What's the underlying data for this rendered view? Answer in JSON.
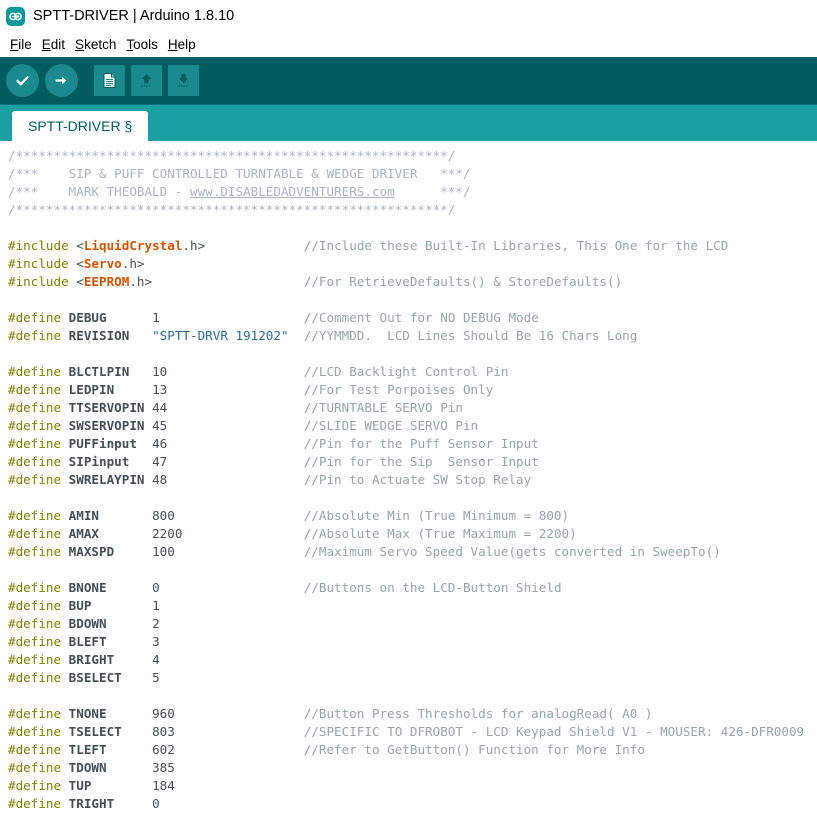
{
  "window": {
    "title": "SPTT-DRIVER | Arduino 1.8.10",
    "logo_icon": "arduino-infinity-icon"
  },
  "menubar": {
    "items": [
      {
        "label": "File",
        "mnemonic": "F",
        "rest": "ile"
      },
      {
        "label": "Edit",
        "mnemonic": "E",
        "rest": "dit"
      },
      {
        "label": "Sketch",
        "mnemonic": "S",
        "rest": "ketch"
      },
      {
        "label": "Tools",
        "mnemonic": "T",
        "rest": "ools"
      },
      {
        "label": "Help",
        "mnemonic": "H",
        "rest": "elp"
      }
    ]
  },
  "toolbar": {
    "buttons": [
      {
        "name": "verify-button",
        "icon": "checkmark-icon",
        "tooltip": "Verify"
      },
      {
        "name": "upload-button",
        "icon": "arrow-right-icon",
        "tooltip": "Upload"
      },
      {
        "name": "new-button",
        "icon": "new-document-icon",
        "tooltip": "New"
      },
      {
        "name": "open-button",
        "icon": "arrow-up-icon",
        "tooltip": "Open"
      },
      {
        "name": "save-button",
        "icon": "arrow-down-icon",
        "tooltip": "Save"
      }
    ]
  },
  "tabs": [
    {
      "label": "SPTT-DRIVER §",
      "active": true
    }
  ],
  "colors": {
    "toolbar_bg": "#005c5f",
    "tabbar_bg": "#1a9fa3",
    "button_bg": "#1a8a8e",
    "accent": "#00979d",
    "comment": "#a8b5c0",
    "preprocessor": "#7e7e00",
    "library": "#d35400",
    "string": "#2d6e8e",
    "identifier": "#434f54"
  },
  "code": {
    "banner": {
      "rule_top": "/*********************************************************/",
      "line_title_prefix": "/***    ",
      "line_title": "SIP & PUFF CONTROLLED TURNTABLE & WEDGE DRIVER",
      "line_title_suffix": "   ***/",
      "line_author_prefix": "/***    ",
      "line_author": "MARK THEOBALD - ",
      "line_author_link": "www.DISABLEDADVENTURERS.com",
      "line_author_suffix": "      ***/",
      "rule_bottom": "/*********************************************************/"
    },
    "includes": [
      {
        "directive": "#include",
        "open": " <",
        "lib": "LiquidCrystal",
        "ext": ".h>",
        "pad": "      ",
        "comment": "//Include these Built-In Libraries, This One for the LCD"
      },
      {
        "directive": "#include",
        "open": " <",
        "lib": "Servo",
        "ext": ".h>",
        "pad": "             ",
        "comment": ""
      },
      {
        "directive": "#include",
        "open": " <",
        "lib": "EEPROM",
        "ext": ".h>",
        "pad": "            ",
        "comment": "//For RetrieveDefaults() & StoreDefaults()"
      }
    ],
    "define_groups": [
      {
        "name": "debug-group",
        "defines": [
          {
            "directive": "#define",
            "id": "DEBUG",
            "value": "1",
            "value_is_string": false,
            "comment": "//Comment Out for NO DEBUG Mode"
          },
          {
            "directive": "#define",
            "id": "REVISION",
            "value": "\"SPTT-DRVR 191202\"",
            "value_is_string": true,
            "comment": "//YYMMDD.  LCD Lines Should Be 16 Chars Long"
          }
        ]
      },
      {
        "name": "pin-group",
        "defines": [
          {
            "directive": "#define",
            "id": "BLCTLPIN",
            "value": "10",
            "value_is_string": false,
            "comment": "//LCD Backlight Control Pin"
          },
          {
            "directive": "#define",
            "id": "LEDPIN",
            "value": "13",
            "value_is_string": false,
            "comment": "//For Test Porpoises Only"
          },
          {
            "directive": "#define",
            "id": "TTSERVOPIN",
            "value": "44",
            "value_is_string": false,
            "comment": "//TURNTABLE SERVO Pin"
          },
          {
            "directive": "#define",
            "id": "SWSERVOPIN",
            "value": "45",
            "value_is_string": false,
            "comment": "//SLIDE WEDGE SERVO Pin"
          },
          {
            "directive": "#define",
            "id": "PUFFinput",
            "value": "46",
            "value_is_string": false,
            "comment": "//Pin for the Puff Sensor Input"
          },
          {
            "directive": "#define",
            "id": "SIPinput",
            "value": "47",
            "value_is_string": false,
            "comment": "//Pin for the Sip  Sensor Input"
          },
          {
            "directive": "#define",
            "id": "SWRELAYPIN",
            "value": "48",
            "value_is_string": false,
            "comment": "//Pin to Actuate SW Stop Relay"
          }
        ]
      },
      {
        "name": "limits-group",
        "defines": [
          {
            "directive": "#define",
            "id": "AMIN",
            "value": "800",
            "value_is_string": false,
            "comment": "//Absolute Min (True Minimum = 800)"
          },
          {
            "directive": "#define",
            "id": "AMAX",
            "value": "2200",
            "value_is_string": false,
            "comment": "//Absolute Max (True Maximum = 2200)"
          },
          {
            "directive": "#define",
            "id": "MAXSPD",
            "value": "100",
            "value_is_string": false,
            "comment": "//Maximum Servo Speed Value(gets converted in SweepTo()"
          }
        ]
      },
      {
        "name": "button-group",
        "defines": [
          {
            "directive": "#define",
            "id": "BNONE",
            "value": "0",
            "value_is_string": false,
            "comment": "//Buttons on the LCD-Button Shield"
          },
          {
            "directive": "#define",
            "id": "BUP",
            "value": "1",
            "value_is_string": false,
            "comment": ""
          },
          {
            "directive": "#define",
            "id": "BDOWN",
            "value": "2",
            "value_is_string": false,
            "comment": ""
          },
          {
            "directive": "#define",
            "id": "BLEFT",
            "value": "3",
            "value_is_string": false,
            "comment": ""
          },
          {
            "directive": "#define",
            "id": "BRIGHT",
            "value": "4",
            "value_is_string": false,
            "comment": ""
          },
          {
            "directive": "#define",
            "id": "BSELECT",
            "value": "5",
            "value_is_string": false,
            "comment": ""
          }
        ]
      },
      {
        "name": "threshold-group",
        "defines": [
          {
            "directive": "#define",
            "id": "TNONE",
            "value": "960",
            "value_is_string": false,
            "comment": "//Button Press Thresholds for analogRead( A0 )"
          },
          {
            "directive": "#define",
            "id": "TSELECT",
            "value": "803",
            "value_is_string": false,
            "comment": "//SPECIFIC TO DFROBOT - LCD Keypad Shield V1 - MOUSER: 426-DFR0009"
          },
          {
            "directive": "#define",
            "id": "TLEFT",
            "value": "602",
            "value_is_string": false,
            "comment": "//Refer to GetButton() Function for More Info"
          },
          {
            "directive": "#define",
            "id": "TDOWN",
            "value": "385",
            "value_is_string": false,
            "comment": ""
          },
          {
            "directive": "#define",
            "id": "TUP",
            "value": "184",
            "value_is_string": false,
            "comment": ""
          },
          {
            "directive": "#define",
            "id": "TRIGHT",
            "value": "0",
            "value_is_string": false,
            "comment": ""
          }
        ]
      }
    ]
  }
}
